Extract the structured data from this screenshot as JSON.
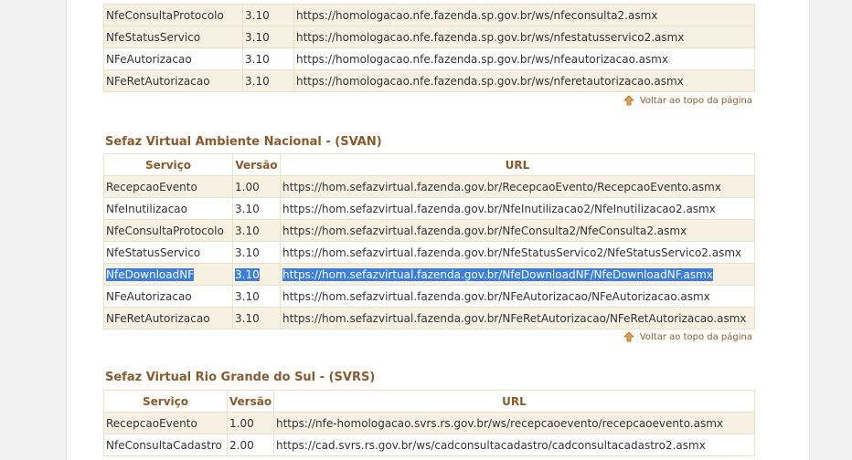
{
  "table1": {
    "rows": [
      {
        "service": "NfeConsultaProtocolo",
        "version": "3.10",
        "url": "https://homologacao.nfe.fazenda.sp.gov.br/ws/nfeconsulta2.asmx"
      },
      {
        "service": "NfeStatusServico",
        "version": "3.10",
        "url": "https://homologacao.nfe.fazenda.sp.gov.br/ws/nfestatusservico2.asmx"
      },
      {
        "service": "NFeAutorizacao",
        "version": "3.10",
        "url": "https://homologacao.nfe.fazenda.sp.gov.br/ws/nfeautorizacao.asmx"
      },
      {
        "service": "NFeRetAutorizacao",
        "version": "3.10",
        "url": "https://homologacao.nfe.fazenda.sp.gov.br/ws/nferetautorizacao.asmx"
      }
    ]
  },
  "back_to_top": "Voltar ao topo da página",
  "svan": {
    "title": "Sefaz Virtual Ambiente Nacional - (SVAN)",
    "headers": {
      "service": "Serviço",
      "version": "Versão",
      "url": "URL"
    },
    "rows": [
      {
        "service": "RecepcaoEvento",
        "version": "1.00",
        "url": "https://hom.sefazvirtual.fazenda.gov.br/RecepcaoEvento/RecepcaoEvento.asmx"
      },
      {
        "service": "NfeInutilizacao",
        "version": "3.10",
        "url": "https://hom.sefazvirtual.fazenda.gov.br/NfeInutilizacao2/NfeInutilizacao2.asmx"
      },
      {
        "service": "NfeConsultaProtocolo",
        "version": "3.10",
        "url": "https://hom.sefazvirtual.fazenda.gov.br/NfeConsulta2/NfeConsulta2.asmx"
      },
      {
        "service": "NfeStatusServico",
        "version": "3.10",
        "url": "https://hom.sefazvirtual.fazenda.gov.br/NfeStatusServico2/NfeStatusServico2.asmx"
      },
      {
        "service": "NfeDownloadNF",
        "version": "3.10",
        "url": "https://hom.sefazvirtual.fazenda.gov.br/NfeDownloadNF/NfeDownloadNF.asmx"
      },
      {
        "service": "NFeAutorizacao",
        "version": "3.10",
        "url": "https://hom.sefazvirtual.fazenda.gov.br/NFeAutorizacao/NFeAutorizacao.asmx"
      },
      {
        "service": "NFeRetAutorizacao",
        "version": "3.10",
        "url": "https://hom.sefazvirtual.fazenda.gov.br/NFeRetAutorizacao/NFeRetAutorizacao.asmx"
      }
    ]
  },
  "svrs": {
    "title": "Sefaz Virtual Rio Grande do Sul - (SVRS)",
    "headers": {
      "service": "Serviço",
      "version": "Versão",
      "url": "URL"
    },
    "rows": [
      {
        "service": "RecepcaoEvento",
        "version": "1.00",
        "url": "https://nfe-homologacao.svrs.rs.gov.br/ws/recepcaoevento/recepcaoevento.asmx"
      },
      {
        "service": "NfeConsultaCadastro",
        "version": "2.00",
        "url": "https://cad.svrs.rs.gov.br/ws/cadconsultacadastro/cadconsultacadastro2.asmx"
      }
    ]
  },
  "colors": {
    "accent": "#8b5a2b",
    "row_alt": "#f7f1e4",
    "selection": "#3b7ee0"
  }
}
